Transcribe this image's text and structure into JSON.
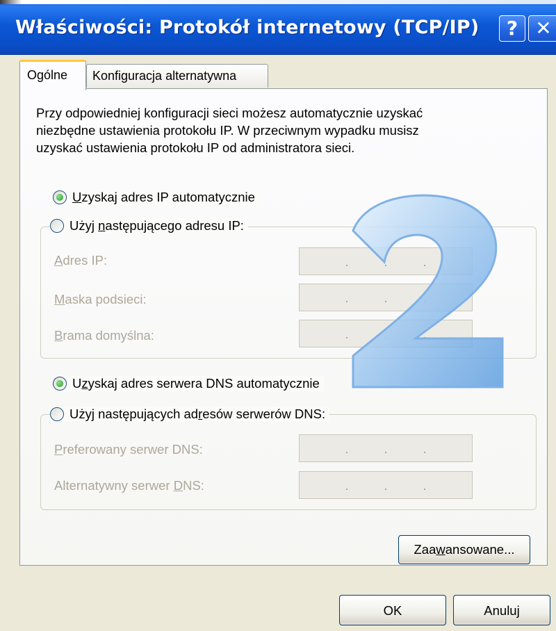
{
  "window": {
    "title": "Właściwości: Protokół internetowy (TCP/IP)",
    "help_glyph": "?",
    "close_glyph": "✕"
  },
  "tabs": [
    {
      "label": "Ogólne",
      "active": true
    },
    {
      "label": "Konfiguracja alternatywna",
      "active": false
    }
  ],
  "description": [
    "Przy odpowiedniej konfiguracji sieci możesz automatycznie uzyskać",
    "niezbędne ustawienia protokołu IP. W przeciwnym wypadku musisz",
    "uzyskać ustawienia protokołu IP od administratora sieci."
  ],
  "ip_section": {
    "auto_radio": {
      "prefix": "",
      "accel": "U",
      "rest": "zyskaj adres IP automatycznie",
      "checked": true
    },
    "manual_radio": {
      "prefix": "Użyj ",
      "accel": "n",
      "rest": "astępującego adresu IP:",
      "checked": false
    },
    "fields": [
      {
        "accel": "A",
        "rest": "dres IP:",
        "value": ". . ."
      },
      {
        "accel": "M",
        "rest": "aska podsieci:",
        "value": ". . ."
      },
      {
        "accel": "B",
        "rest": "rama domyślna:",
        "value": ". . ."
      }
    ]
  },
  "dns_section": {
    "auto_radio": {
      "prefix": "U",
      "accel": "z",
      "rest": "yskaj adres serwera DNS automatycznie",
      "checked": true
    },
    "manual_radio": {
      "prefix": "Użyj następujących ad",
      "accel": "r",
      "rest": "esów serwerów DNS:",
      "checked": false
    },
    "fields": [
      {
        "prefix": "",
        "accel": "P",
        "rest": "referowany serwer DNS:"
      },
      {
        "prefix": "Alternatywny serwer ",
        "accel": "D",
        "rest": "NS:"
      }
    ]
  },
  "buttons": {
    "advanced": {
      "prefix": "Zaa",
      "accel": "w",
      "rest": "ansowane..."
    },
    "ok": "OK",
    "cancel": "Anuluj"
  },
  "overlay": {
    "digit": "2",
    "color": "#9cc6ef"
  },
  "colors": {
    "titlebar": "#0a52d0",
    "dialog_bg": "#ece9d8",
    "tab_highlight": "#ffc83c",
    "disabled_text": "#aca899"
  }
}
